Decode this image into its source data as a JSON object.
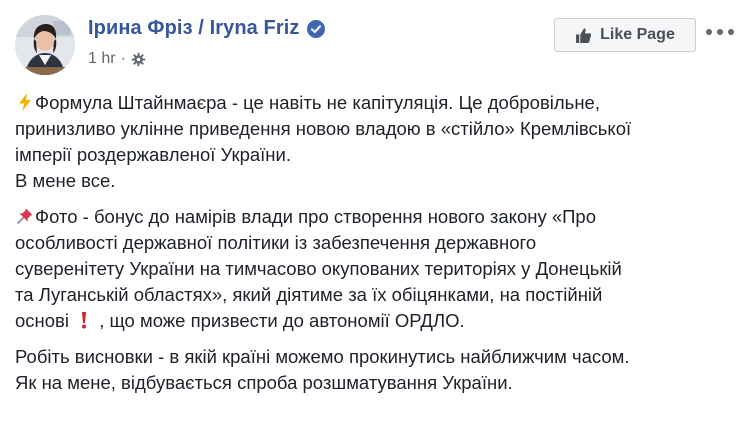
{
  "post": {
    "author": "Ірина Фріз / Iryna Friz",
    "time": "1 hr",
    "separator": "·",
    "like_page_label": "Like Page",
    "icons": {
      "avatar": "profile-photo",
      "verified": "verified-badge-icon",
      "audience": "gear-icon",
      "like": "thumbs-up-icon",
      "more": "more-dots-icon",
      "para1": "lightning-emoji",
      "para2": "pushpin-emoji",
      "para2_mid": "exclamation-emoji"
    },
    "colors": {
      "author": "#365899",
      "text": "#1d2129",
      "meta": "#606770",
      "verified": "#4267b2"
    }
  },
  "paragraphs": {
    "p1": {
      "line1": "Формула Штайнмаєра - це навіть не капітуляція. Це добровільне,",
      "line2": "принизливо уклінне приведення новою владою в «стійло» Кремлівської",
      "line3": "імперії роздержавленої України.",
      "line4": "В мене все."
    },
    "p2": {
      "line1": "Фото - бонус до намірів влади про створення нового закону «Про",
      "line2": "особливості державної політики із забезпечення державного",
      "line3": "суверенітету України на тимчасово окупованих територіях у Донецькій",
      "line4": "та Луганській областях», який діятиме за їх обіцянками, на постійній",
      "line5a": "основі",
      "line5b": ", що може призвести до автономії ОРДЛО."
    },
    "p3": {
      "line1": "Робіть висновки - в якій країні можемо прокинутись найближчим часом.",
      "line2": "Як на мене, відбувається спроба розшматування України."
    }
  }
}
